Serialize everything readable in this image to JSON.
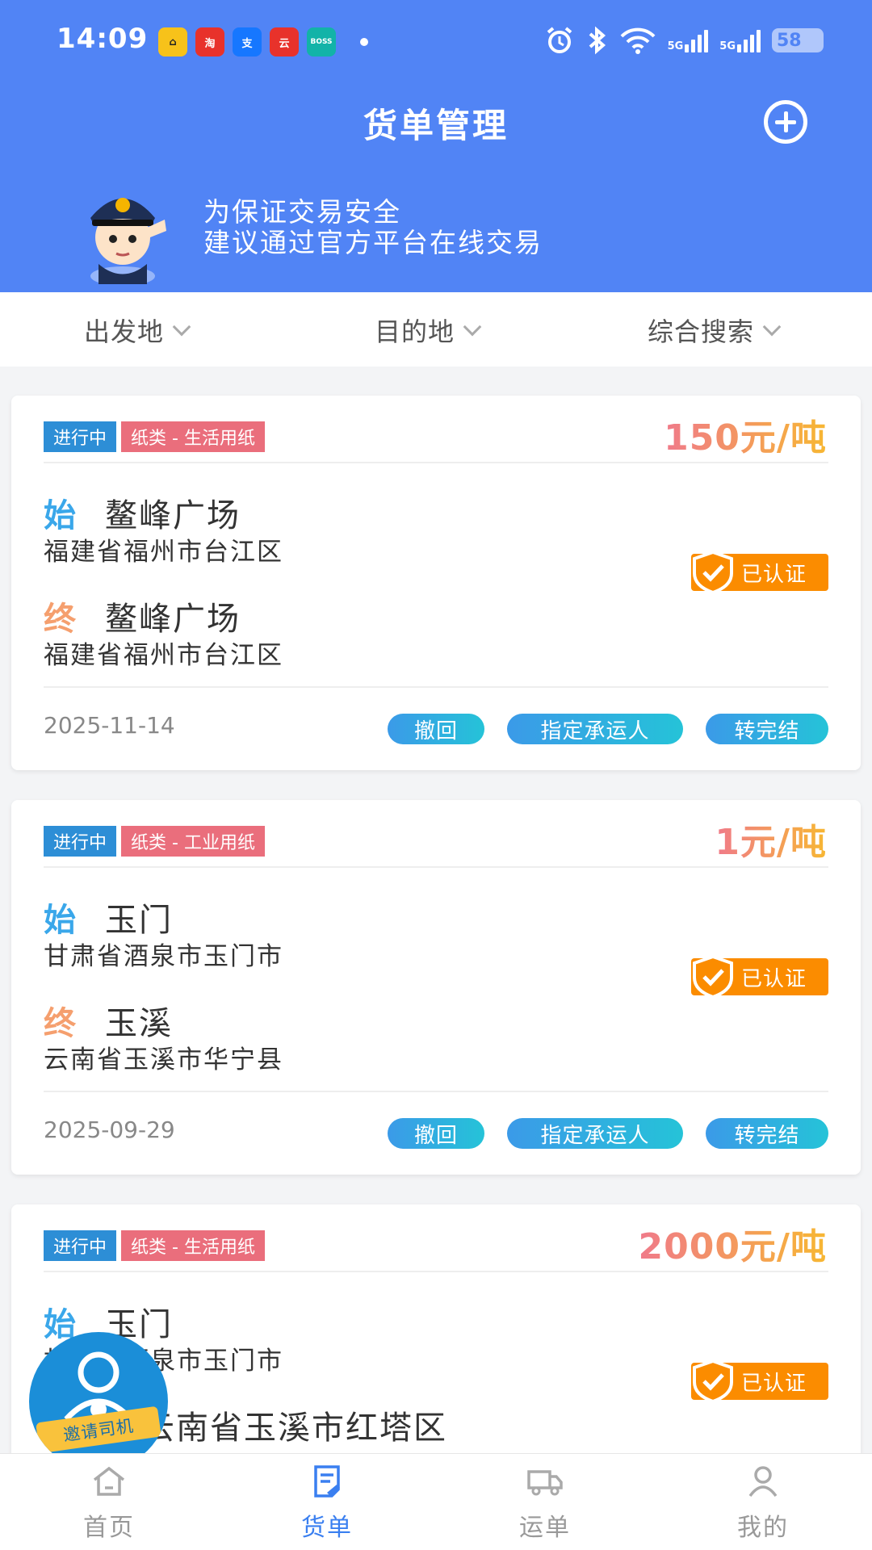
{
  "status_bar": {
    "time": "14:09",
    "apps": [
      {
        "name": "amap-icon",
        "label": "⌂",
        "bg": "#f7c21a",
        "fg": "#222"
      },
      {
        "name": "taobao-icon",
        "label": "淘",
        "bg": "#e8322b",
        "fg": "#fff"
      },
      {
        "name": "alipay-icon",
        "label": "支",
        "bg": "#1677ff",
        "fg": "#fff"
      },
      {
        "name": "yunshanfu-icon",
        "label": "云",
        "bg": "#e8322b",
        "fg": "#fff"
      },
      {
        "name": "boss-icon",
        "label": "BOSS",
        "bg": "#12b3a8",
        "fg": "#fff"
      }
    ],
    "network_5g_a": "5G",
    "network_5g_b": "5G",
    "battery": "58"
  },
  "header": {
    "title": "货单管理",
    "notice_line1": "为保证交易安全",
    "notice_line2": "建议通过官方平台在线交易"
  },
  "filters": {
    "origin": "出发地",
    "destination": "目的地",
    "search": "综合搜索"
  },
  "cards": [
    {
      "status": "进行中",
      "category": "纸类 - 生活用纸",
      "price": "150元/吨",
      "start_label": "始",
      "start_place": "鳌峰广场",
      "start_addr": "福建省福州市台江区",
      "end_label": "终",
      "end_place": "鳌峰广场",
      "end_addr": "福建省福州市台江区",
      "verified": "已认证",
      "date": "2025-11-14",
      "btn_withdraw": "撤回",
      "btn_assign": "指定承运人",
      "btn_complete": "转完结"
    },
    {
      "status": "进行中",
      "category": "纸类 - 工业用纸",
      "price": "1元/吨",
      "start_label": "始",
      "start_place": "玉门",
      "start_addr": "甘肃省酒泉市玉门市",
      "end_label": "终",
      "end_place": "玉溪",
      "end_addr": "云南省玉溪市华宁县",
      "verified": "已认证",
      "date": "2025-09-29",
      "btn_withdraw": "撤回",
      "btn_assign": "指定承运人",
      "btn_complete": "转完结"
    },
    {
      "status": "进行中",
      "category": "纸类 - 生活用纸",
      "price": "2000元/吨",
      "start_label": "始",
      "start_place": "玉门",
      "start_addr": "甘肃省酒泉市玉门市",
      "end_place": "云南省玉溪市红塔区",
      "verified": "已认证"
    }
  ],
  "invite": {
    "label": "邀请司机"
  },
  "tabbar": {
    "home": "首页",
    "cargo": "货单",
    "waybill": "运单",
    "mine": "我的",
    "active": "cargo"
  },
  "colors": {
    "primary": "#5184f5",
    "tab_active": "#3a7ff0",
    "verified_orange": "#fb8c00",
    "status_blue": "#2d8ed6",
    "category_pink": "#ea6e7c"
  }
}
